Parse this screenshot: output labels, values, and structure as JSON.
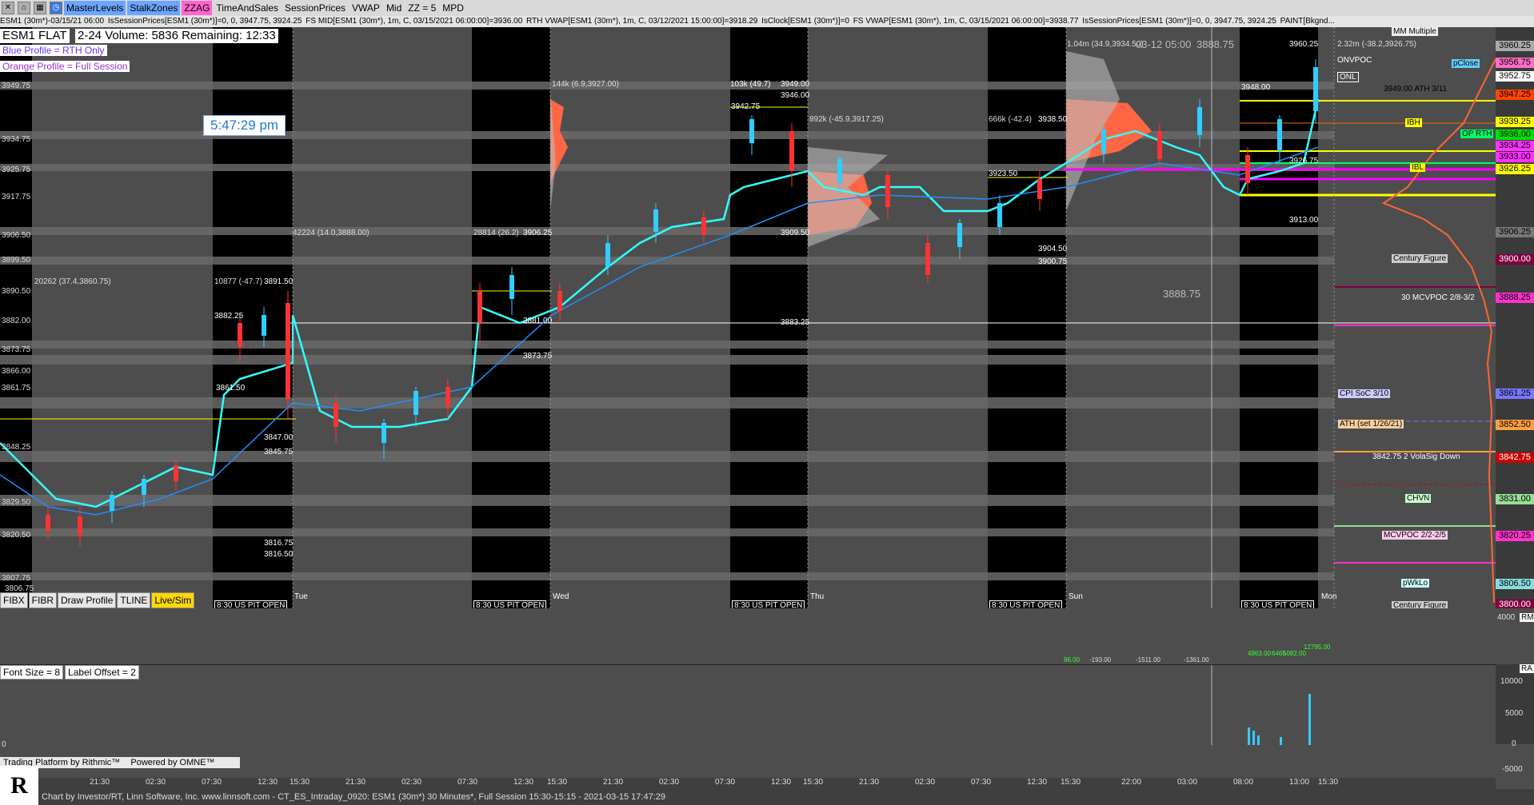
{
  "toolbar": {
    "items": [
      "MasterLevels",
      "StalkZones",
      "ZZAG",
      "TimeAndSales",
      "SessionPrices",
      "VWAP",
      "Mid",
      "ZZ = 5",
      "MPD"
    ]
  },
  "statusline": {
    "items": [
      "ESM1 (30m*)-03/15/21 06:00",
      "IsSessionPrices[ESM1 (30m*)]=0, 0, 3947.75, 3924.25",
      "FS MID[ESM1 (30m*), 1m, C, 03/15/2021 06:00:00]=3936.00",
      "RTH VWAP[ESM1 (30m*), 1m, C, 03/12/2021 15:00:00]=3918.29",
      "IsClock[ESM1 (30m*)]=0",
      "FS VWAP[ESM1 (30m*), 1m, C, 03/15/2021 06:00:00]=3938.77",
      "IsSessionPrices[ESM1 (30m*)]=0, 0, 3947.75, 3924.25",
      "PAINT[Bkgnd..."
    ]
  },
  "header": {
    "symbol": "ESM1 FLAT",
    "volume_text": "2-24 Volume: 5836 Remaining: 12:33",
    "blue_profile": "Blue Profile = RTH Only",
    "orange_profile": "Orange Profile = Full Session",
    "clock": "5:47:29 pm"
  },
  "price_axis": {
    "labels": [
      {
        "text": "3960.25",
        "color": "#2a2a2a"
      },
      {
        "text": "3956.75",
        "color": "#ff6ec7"
      },
      {
        "text": "3952.75",
        "color": "#ffffff"
      },
      {
        "text": "3947.25",
        "color": "#ff4500"
      },
      {
        "text": "3939.25",
        "color": "#ffff00"
      },
      {
        "text": "3936.00",
        "color": "#00e000"
      },
      {
        "text": "3934.25",
        "color": "#ff33ff"
      },
      {
        "text": "3933.00",
        "color": "#ff33ff"
      },
      {
        "text": "3926.25",
        "color": "#ffff00"
      },
      {
        "text": "3906.25",
        "color": "#777777"
      },
      {
        "text": "3900.00",
        "color": "#800040"
      },
      {
        "text": "3888.25",
        "color": "#ff33cc"
      },
      {
        "text": "3861.25",
        "color": "#7777ff"
      },
      {
        "text": "3852.50",
        "color": "#ffa040"
      },
      {
        "text": "3842.75",
        "color": "#cc0000"
      },
      {
        "text": "3831.00",
        "color": "#99dd99"
      },
      {
        "text": "3820.25",
        "color": "#ff33cc"
      },
      {
        "text": "3806.50",
        "color": "#88dddd"
      },
      {
        "text": "3800.00",
        "color": "#800040"
      }
    ],
    "left_labels": [
      "3949.75",
      "3934.75",
      "3925.75",
      "3917.75",
      "3906.50",
      "3899.50",
      "3890.50",
      "3882.00",
      "3873.75",
      "3866.00",
      "3861.75",
      "3848.25",
      "3829.50",
      "3820.50",
      "3807.75",
      "3806.75"
    ]
  },
  "levels": [
    {
      "text": "MM Multiple"
    },
    {
      "text": "ONVPOC"
    },
    {
      "text": "pClose"
    },
    {
      "text": "ONL"
    },
    {
      "text": "3949.00 ATH 3/11"
    },
    {
      "text": "IBH"
    },
    {
      "text": "OP RTH"
    },
    {
      "text": "IBL"
    },
    {
      "text": "Century Figure"
    },
    {
      "text": "30 MCVPOC 2/8-3/2"
    },
    {
      "text": "CPI SoC 3/10"
    },
    {
      "text": "ATH (set 1/26/21)"
    },
    {
      "text": "3842.75 2 VolaSig Down"
    },
    {
      "text": "CHVN"
    },
    {
      "text": "MCVPOC 2/2-2/5"
    },
    {
      "text": "pWkLo"
    },
    {
      "text": "Century Figure"
    }
  ],
  "annotations": [
    {
      "text": "20262 (37.4,3860.75)"
    },
    {
      "text": "10877 (-47.7)"
    },
    {
      "text": "3891.50"
    },
    {
      "text": "42224 (14.0,3888.00)"
    },
    {
      "text": "28814 (26.2)"
    },
    {
      "text": "3906.25"
    },
    {
      "text": "144k (6.9,3927.00)"
    },
    {
      "text": "103k (49.7)"
    },
    {
      "text": "3949.00"
    },
    {
      "text": "3946.00"
    },
    {
      "text": "3942.75"
    },
    {
      "text": "892k (-45.9,3917.25)"
    },
    {
      "text": "666k (-42.4)"
    },
    {
      "text": "3938.50"
    },
    {
      "text": "1.04m (34.9,3934.50)"
    },
    {
      "text": "03-12 05:00"
    },
    {
      "text": "3888.75"
    },
    {
      "text": "3960.25"
    },
    {
      "text": "2.32m (-38.2,3926.75)"
    },
    {
      "text": "3948.00"
    },
    {
      "text": "3926.75"
    },
    {
      "text": "3913.00"
    },
    {
      "text": "3909.50"
    },
    {
      "text": "3904.50"
    },
    {
      "text": "3900.75"
    },
    {
      "text": "3883.25"
    },
    {
      "text": "3881.00"
    },
    {
      "text": "3873.75"
    },
    {
      "text": "3847.00"
    },
    {
      "text": "3845.75"
    },
    {
      "text": "3816.75"
    },
    {
      "text": "3816.50"
    },
    {
      "text": "3861.50"
    },
    {
      "text": "3882.25"
    },
    {
      "text": "3923.50"
    },
    {
      "text": "3888.75"
    }
  ],
  "sessions": [
    "8:30 US PIT OPEN",
    "8:30 US PIT OPEN",
    "8:30 US PIT OPEN",
    "8:30 US PIT OPEN",
    "8:30 US PIT OPEN"
  ],
  "days": [
    "Tue",
    "Wed",
    "Thu",
    "Sun",
    "Mon"
  ],
  "bottom_buttons": [
    "FIBX",
    "FIBR",
    "Draw Profile",
    "TLINE",
    "Live/Sim"
  ],
  "lower_panel": {
    "font_size": "Font Size = 8",
    "label_offset": "Label Offset = 2",
    "scale": [
      "10000",
      "5000",
      "0",
      "-5000"
    ],
    "values": [
      "96.00",
      "-193.00",
      "-1511.00",
      "-1361.00",
      "4963.00",
      "6465",
      "5082.00",
      "12795.00"
    ],
    "left_zero": "0",
    "ra": "RA",
    "rm": "RM",
    "axis_top": "4000",
    "axis_zero": "0"
  },
  "timeaxis": [
    "21:30",
    "02:30",
    "07:30",
    "12:30",
    "15:30",
    "21:30",
    "02:30",
    "07:30",
    "12:30",
    "15:30",
    "21:30",
    "02:30",
    "07:30",
    "12:30",
    "15:30",
    "21:30",
    "02:30",
    "07:30",
    "12:30",
    "15:30",
    "22:00",
    "03:00",
    "08:00",
    "13:00",
    "15:30"
  ],
  "platform": [
    "Trading Platform by Rithmic™",
    "Powered by OMNE™"
  ],
  "footer": "Chart by Investor/RT, Linn Software, Inc. www.linnsoft.com - CT_ES_Intraday_0920: ESM1 (30m*) 30 Minutes*, Full Session 15:30-15:15 - 2021-03-15 17:47:29",
  "logo": "R"
}
